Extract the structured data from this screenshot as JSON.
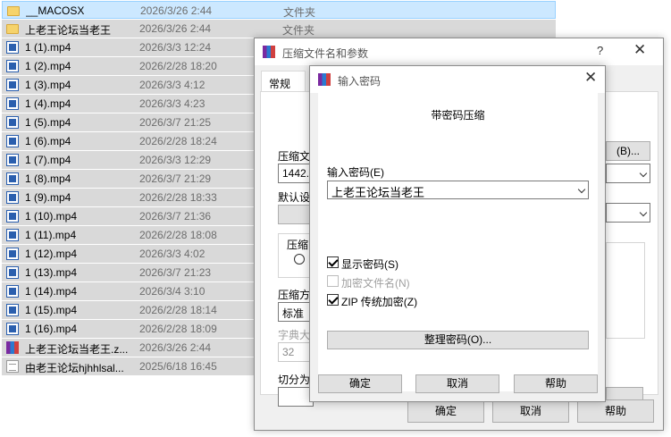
{
  "files": [
    {
      "name": "__MACOSX",
      "date": "2026/3/26 2:44",
      "type": "文件夹",
      "icon": "folder-icon",
      "state": "selected"
    },
    {
      "name": "上老王论坛当老王",
      "date": "2026/3/26 2:44",
      "type": "文件夹",
      "icon": "folder-icon",
      "state": "gray"
    },
    {
      "name": "1 (1).mp4",
      "date": "2026/3/3 12:24",
      "type": "",
      "icon": "video-file-icon",
      "state": "gray"
    },
    {
      "name": "1 (2).mp4",
      "date": "2026/2/28 18:20",
      "type": "",
      "icon": "video-file-icon",
      "state": "gray"
    },
    {
      "name": "1 (3).mp4",
      "date": "2026/3/3 4:12",
      "type": "",
      "icon": "video-file-icon",
      "state": "gray"
    },
    {
      "name": "1 (4).mp4",
      "date": "2026/3/3 4:23",
      "type": "",
      "icon": "video-file-icon",
      "state": "gray"
    },
    {
      "name": "1 (5).mp4",
      "date": "2026/3/7 21:25",
      "type": "",
      "icon": "video-file-icon",
      "state": "gray"
    },
    {
      "name": "1 (6).mp4",
      "date": "2026/2/28 18:24",
      "type": "",
      "icon": "video-file-icon",
      "state": "gray"
    },
    {
      "name": "1 (7).mp4",
      "date": "2026/3/3 12:29",
      "type": "",
      "icon": "video-file-icon",
      "state": "gray"
    },
    {
      "name": "1 (8).mp4",
      "date": "2026/3/7 21:29",
      "type": "",
      "icon": "video-file-icon",
      "state": "gray"
    },
    {
      "name": "1 (9).mp4",
      "date": "2026/2/28 18:33",
      "type": "",
      "icon": "video-file-icon",
      "state": "gray"
    },
    {
      "name": "1 (10).mp4",
      "date": "2026/3/7 21:36",
      "type": "",
      "icon": "video-file-icon",
      "state": "gray"
    },
    {
      "name": "1 (11).mp4",
      "date": "2026/2/28 18:08",
      "type": "",
      "icon": "video-file-icon",
      "state": "gray"
    },
    {
      "name": "1 (12).mp4",
      "date": "2026/3/3 4:02",
      "type": "",
      "icon": "video-file-icon",
      "state": "gray"
    },
    {
      "name": "1 (13).mp4",
      "date": "2026/3/7 21:23",
      "type": "",
      "icon": "video-file-icon",
      "state": "gray"
    },
    {
      "name": "1 (14).mp4",
      "date": "2026/3/4 3:10",
      "type": "",
      "icon": "video-file-icon",
      "state": "gray"
    },
    {
      "name": "1 (15).mp4",
      "date": "2026/2/28 18:14",
      "type": "",
      "icon": "video-file-icon",
      "state": "gray"
    },
    {
      "name": "1 (16).mp4",
      "date": "2026/2/28 18:09",
      "type": "",
      "icon": "video-file-icon",
      "state": "gray"
    },
    {
      "name": "上老王论坛当老王.z...",
      "date": "2026/3/26 2:44",
      "type": "",
      "icon": "rar-archive-icon",
      "state": "gray"
    },
    {
      "name": "由老王论坛hjhhlsal...",
      "date": "2025/6/18 16:45",
      "type": "",
      "icon": "text-file-icon",
      "state": "gray"
    }
  ],
  "archive_dialog": {
    "title": "压缩文件名和参数",
    "help": "?",
    "close": "✕",
    "tab_general": "常规",
    "archive_name_label": "压缩文",
    "archive_name_value": "1442.z",
    "browse_button": "(B)...",
    "default_profile_label": "默认设",
    "format_group_label": "压缩",
    "radio_label": "R",
    "method_label": "压缩方",
    "method_value": "标准",
    "dict_label": "字典大",
    "dict_value": "32",
    "split_label": "切分为",
    "ok": "确定",
    "cancel": "取消",
    "help_button": "帮助"
  },
  "password_dialog": {
    "title": "输入密码",
    "close": "✕",
    "heading": "带密码压缩",
    "enter_label": "输入密码(E)",
    "password_value": "上老王论坛当老王",
    "show_password_label": "显示密码(S)",
    "show_password_checked": true,
    "encrypt_names_label": "加密文件名(N)",
    "encrypt_names_checked": false,
    "zip_legacy_label": "ZIP 传统加密(Z)",
    "zip_legacy_checked": true,
    "organize_button": "整理密码(O)...",
    "ok": "确定",
    "cancel": "取消",
    "help_button": "帮助"
  }
}
